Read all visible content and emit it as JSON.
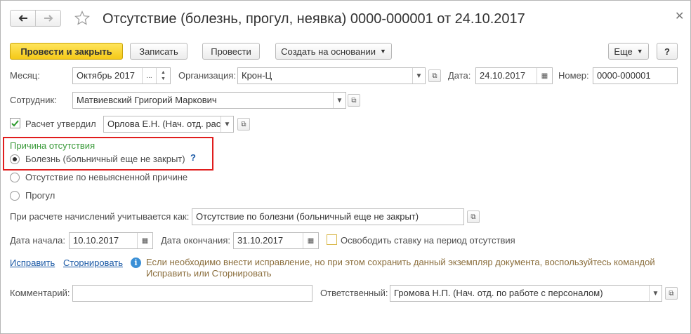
{
  "window": {
    "title": "Отсутствие (болезнь, прогул, неявка) 0000-000001 от 24.10.2017"
  },
  "toolbar": {
    "post_and_close": "Провести и закрыть",
    "save": "Записать",
    "post": "Провести",
    "create_based_on": "Создать на основании",
    "more": "Еще",
    "help": "?"
  },
  "fields": {
    "month_label": "Месяц:",
    "month_value": "Октябрь 2017",
    "org_label": "Организация:",
    "org_value": "Крон-Ц",
    "date_label": "Дата:",
    "date_value": "24.10.2017",
    "number_label": "Номер:",
    "number_value": "0000-000001",
    "employee_label": "Сотрудник:",
    "employee_value": "Матвиевский Григорий Маркович",
    "approved_label": "Расчет утвердил",
    "approved_value": "Орлова Е.Н. (Нач. отд. рас",
    "accrual_label": "При расчете начислений учитывается как:",
    "accrual_value": "Отсутствие по болезни (больничный еще не закрыт)",
    "start_label": "Дата начала:",
    "start_value": "10.10.2017",
    "end_label": "Дата окончания:",
    "end_value": "31.10.2017",
    "release_label": "Освободить ставку на период отсутствия",
    "comment_label": "Комментарий:",
    "comment_value": "",
    "responsible_label": "Ответственный:",
    "responsible_value": "Громова Н.П. (Нач. отд. по работе с персоналом)"
  },
  "reason": {
    "title": "Причина отсутствия",
    "options": [
      {
        "label": "Болезнь (больничный еще не закрыт)",
        "selected": true
      },
      {
        "label": "Отсутствие по невыясненной причине",
        "selected": false
      },
      {
        "label": "Прогул",
        "selected": false
      }
    ],
    "hint": "?"
  },
  "correction": {
    "fix_link": "Исправить",
    "reverse_link": "Сторнировать",
    "info_line1": "Если необходимо внести исправление, но при этом сохранить данный экземпляр документа, воспользуйтесь командой",
    "info_line2": "Исправить или Сторнировать"
  },
  "colors": {
    "primary": "#f5c918",
    "highlight": "#e01d1d",
    "link": "#1c5aa6",
    "group_title": "#3a9a3a",
    "info": "#8a6d3b"
  }
}
